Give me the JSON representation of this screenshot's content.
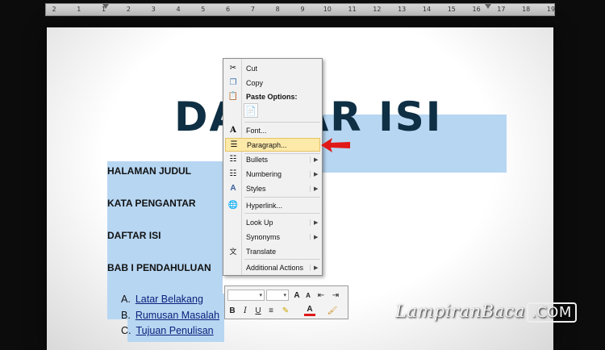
{
  "ruler": {
    "numbers": [
      "2",
      "1",
      "1",
      "2",
      "3",
      "4",
      "5",
      "6",
      "7",
      "8",
      "9",
      "10",
      "11",
      "12",
      "13",
      "14",
      "15",
      "16",
      "17",
      "18",
      "19"
    ]
  },
  "document": {
    "title": "DAFTAR ISI",
    "toc": [
      "HALAMAN JUDUL",
      "KATA PENGANTAR",
      "DAFTAR ISI",
      "BAB I PENDAHULUAN"
    ],
    "subitems": [
      {
        "letter": "A.",
        "text": "Latar Belakang"
      },
      {
        "letter": "B.",
        "text": "Rumusan Masalah"
      },
      {
        "letter": "C.",
        "text": "Tujuan Penulisan"
      }
    ]
  },
  "context_menu": {
    "cut": "Cut",
    "copy": "Copy",
    "paste_options": "Paste Options:",
    "font": "Font...",
    "paragraph": "Paragraph...",
    "bullets": "Bullets",
    "numbering": "Numbering",
    "styles": "Styles",
    "hyperlink": "Hyperlink...",
    "look_up": "Look Up",
    "synonyms": "Synonyms",
    "translate": "Translate",
    "additional_actions": "Additional Actions"
  },
  "mini_toolbar": {
    "bold": "B",
    "italic": "I",
    "underline": "U",
    "font_color": "A"
  },
  "watermark": {
    "text": "LampiranBaca",
    "suffix": ".COM"
  },
  "colors": {
    "selection": "#b7d6f2",
    "menu_highlight": "#fde9a8",
    "arrow": "#e01818",
    "title": "#0e2f44"
  }
}
